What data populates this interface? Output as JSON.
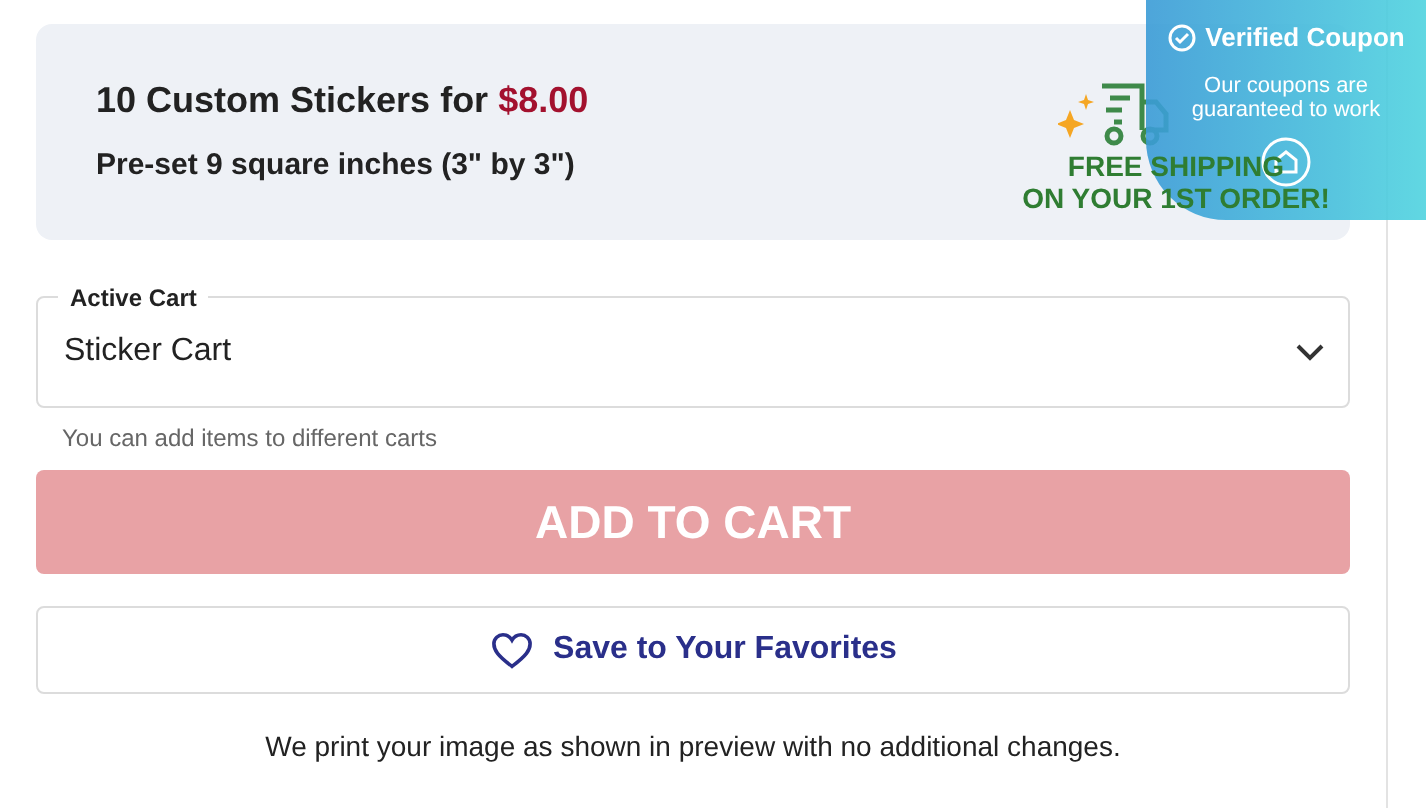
{
  "offer": {
    "title": "10 Custom Stickers for ",
    "price": "$8.00",
    "subtitle": "Pre-set 9 square inches (3\" by 3\")",
    "shipping": [
      "FREE SHIPPING",
      "ON YOUR 1ST ORDER!"
    ]
  },
  "coupon_badge": {
    "title": "Verified Coupon",
    "text": "Our coupons are guaranteed to work"
  },
  "cart_select": {
    "label": "Active Cart",
    "value": "Sticker Cart",
    "helper": "You can add items to different carts"
  },
  "add_to_cart": {
    "label": "ADD TO CART",
    "disabled": true
  },
  "favorites": {
    "label": "Save to Your Favorites"
  },
  "note": "We print your image as shown in preview with no additional changes."
}
